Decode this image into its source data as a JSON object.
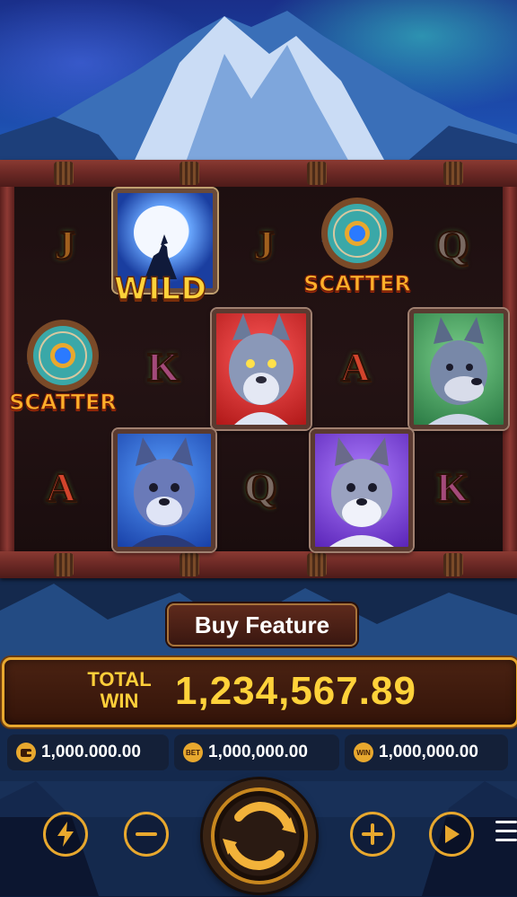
{
  "reels": {
    "wild_label": "WILD",
    "scatter_label": "SCATTER",
    "letters": [
      "J",
      "J",
      "Q",
      "K",
      "A",
      "A",
      "Q",
      "K"
    ]
  },
  "buy_feature": {
    "label": "Buy Feature"
  },
  "total_win": {
    "label_line1": "TOTAL",
    "label_line2": "WIN",
    "value": "1,234,567.89"
  },
  "stats": {
    "balance": {
      "icon": "wallet-icon",
      "value": "1,000.000.00"
    },
    "bet": {
      "icon": "bet-icon",
      "icon_text": "BET",
      "value": "1,000,000.00"
    },
    "win": {
      "icon": "win-icon",
      "icon_text": "WIN",
      "value": "1,000,000.00"
    }
  },
  "controls": {
    "turbo": "lightning-icon",
    "decrease": "minus-icon",
    "spin": "spin-icon",
    "increase": "plus-icon",
    "autoplay": "play-icon",
    "menu": "hamburger-menu-icon"
  },
  "colors": {
    "gold": "#e8a82e",
    "frame": "#6e2a26",
    "win_text": "#ffd23a"
  }
}
